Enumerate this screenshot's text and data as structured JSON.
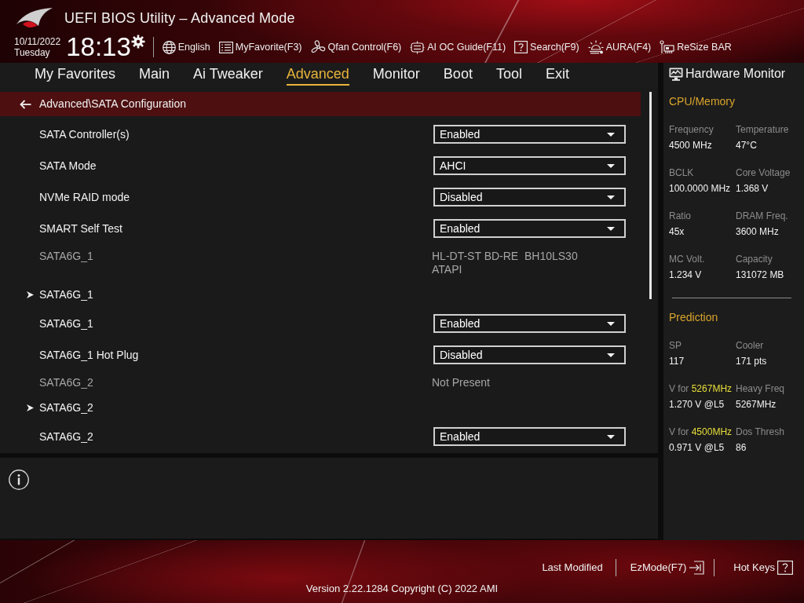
{
  "header": {
    "title": "UEFI BIOS Utility – Advanced Mode",
    "date": "10/11/2022",
    "weekday": "Tuesday",
    "time": "18:13",
    "toolbar": [
      {
        "kind": "language",
        "label": "English"
      },
      {
        "kind": "favorites",
        "label": "MyFavorite(F3)"
      },
      {
        "kind": "qfan",
        "label": "Qfan Control(F6)"
      },
      {
        "kind": "ai_oc",
        "label": "AI OC Guide(F11)"
      },
      {
        "kind": "search",
        "label": "Search(F9)"
      },
      {
        "kind": "aura",
        "label": "AURA(F4)"
      },
      {
        "kind": "resize_bar",
        "label": "ReSize BAR"
      }
    ]
  },
  "tabs": [
    {
      "label": "My Favorites",
      "selected": false
    },
    {
      "label": "Main",
      "selected": false
    },
    {
      "label": "Ai Tweaker",
      "selected": false
    },
    {
      "label": "Advanced",
      "selected": true
    },
    {
      "label": "Monitor",
      "selected": false
    },
    {
      "label": "Boot",
      "selected": false
    },
    {
      "label": "Tool",
      "selected": false
    },
    {
      "label": "Exit",
      "selected": false
    }
  ],
  "breadcrumb": "Advanced\\SATA Configuration",
  "settings": [
    {
      "kind": "dropdown",
      "label": "SATA Controller(s)",
      "value": "Enabled"
    },
    {
      "kind": "dropdown",
      "label": "SATA Mode",
      "value": "AHCI"
    },
    {
      "kind": "dropdown",
      "label": "NVMe RAID mode",
      "value": "Disabled"
    },
    {
      "kind": "dropdown",
      "label": "SMART Self Test",
      "value": "Enabled"
    },
    {
      "kind": "info",
      "label": "SATA6G_1",
      "lines": [
        "HL-DT-ST BD-RE  BH10LS30",
        "ATAPI"
      ]
    },
    {
      "kind": "submenu",
      "label": "SATA6G_1"
    },
    {
      "kind": "dropdown",
      "label": "SATA6G_1",
      "value": "Enabled"
    },
    {
      "kind": "dropdown",
      "label": "SATA6G_1 Hot Plug",
      "value": "Disabled"
    },
    {
      "kind": "info",
      "label": "SATA6G_2",
      "lines": [
        "Not Present"
      ]
    },
    {
      "kind": "submenu",
      "label": "SATA6G_2"
    },
    {
      "kind": "dropdown",
      "label": "SATA6G_2",
      "value": "Enabled"
    }
  ],
  "hardware_monitor": {
    "title": "Hardware Monitor",
    "sections": [
      {
        "title": "CPU/Memory",
        "items": [
          {
            "label": "Frequency",
            "value": "4500 MHz"
          },
          {
            "label": "Temperature",
            "value": "47°C"
          },
          {
            "label": "BCLK",
            "value": "100.0000 MHz"
          },
          {
            "label": "Core Voltage",
            "value": "1.368 V"
          },
          {
            "label": "Ratio",
            "value": "45x"
          },
          {
            "label": "DRAM Freq.",
            "value": "3600 MHz"
          },
          {
            "label": "MC Volt.",
            "value": "1.234 V"
          },
          {
            "label": "Capacity",
            "value": "131072 MB"
          }
        ]
      },
      {
        "title": "Prediction",
        "items": [
          {
            "label": "SP",
            "value": "117"
          },
          {
            "label": "Cooler",
            "value": "171 pts"
          },
          {
            "label": "V for",
            "highlight": "5267MHz",
            "value": "1.270 V @L5"
          },
          {
            "label": "Heavy Freq",
            "value": "5267MHz"
          },
          {
            "label": "V for",
            "highlight": "4500MHz",
            "value": "0.971 V @L5"
          },
          {
            "label": "Dos Thresh",
            "value": "86"
          }
        ]
      }
    ]
  },
  "footer": {
    "actions": [
      {
        "kind": "last_modified",
        "label": "Last Modified"
      },
      {
        "kind": "ezmode",
        "label": "EzMode(F7)"
      },
      {
        "kind": "hotkeys",
        "label": "Hot Keys"
      }
    ],
    "version": "Version 2.22.1284 Copyright (C) 2022 AMI"
  }
}
